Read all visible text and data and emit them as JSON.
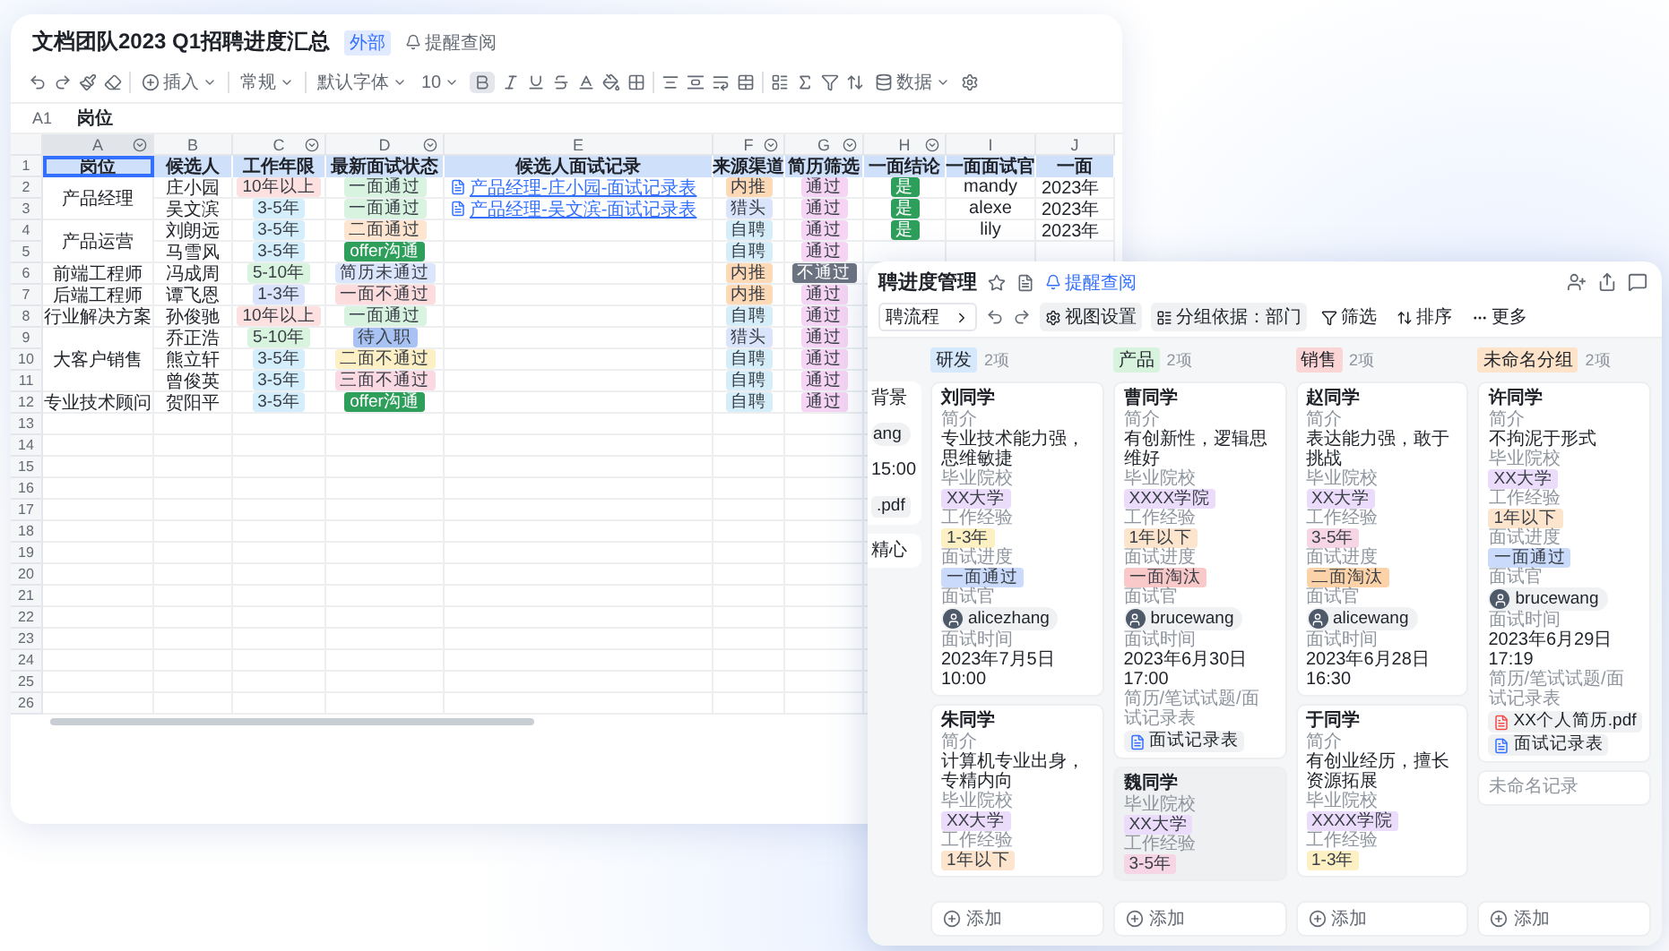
{
  "sheet": {
    "title": "文档团队2023 Q1招聘进度汇总",
    "badge": "外部",
    "remind": "提醒查阅",
    "toolbar": {
      "insert": "插入",
      "number_format": "常规",
      "font": "默认字体",
      "font_size": "10",
      "data": "数据",
      "bold": true
    },
    "cell_ref": "A1",
    "formula": "岗位",
    "columns": [
      {
        "letter": "A",
        "filter": true,
        "selected": true
      },
      {
        "letter": "B",
        "filter": false,
        "selected": false
      },
      {
        "letter": "C",
        "filter": true,
        "selected": false
      },
      {
        "letter": "D",
        "filter": true,
        "selected": false
      },
      {
        "letter": "E",
        "filter": false,
        "selected": false
      },
      {
        "letter": "F",
        "filter": true,
        "selected": false
      },
      {
        "letter": "G",
        "filter": true,
        "selected": false
      },
      {
        "letter": "H",
        "filter": true,
        "selected": false
      },
      {
        "letter": "I",
        "filter": false,
        "selected": false
      },
      {
        "letter": "J",
        "filter": false,
        "selected": false
      }
    ],
    "row_numbers": [
      "1",
      "2",
      "3",
      "4",
      "5",
      "6",
      "7",
      "8",
      "9",
      "10",
      "11",
      "12",
      "13",
      "14",
      "15",
      "16",
      "17",
      "18",
      "19",
      "20",
      "21",
      "22",
      "23",
      "24",
      "25",
      "26"
    ],
    "header": [
      "岗位",
      "候选人",
      "工作年限",
      "最新面试状态",
      "候选人面试记录",
      "来源渠道",
      "简历筛选",
      "一面结论",
      "一面面试官",
      "一面"
    ],
    "groups": [
      {
        "position": "产品经理",
        "candidates": [
          {
            "name": "庄小园",
            "years": {
              "text": "10年以上",
              "color": "#fde0e0"
            },
            "status": {
              "text": "一面通过",
              "color": "#d9f3e1"
            },
            "record": "产品经理-庄小园-面试记录表",
            "source": {
              "text": "内推",
              "color": "#fdd9b5"
            },
            "screening": {
              "text": "通过",
              "color": "#f6d4f4"
            },
            "result": {
              "text": "是",
              "color": "#2e9e5b"
            },
            "interviewer": "mandy",
            "date": "2023年"
          },
          {
            "name": "吴文滨",
            "years": {
              "text": "3-5年",
              "color": "#d5eefb"
            },
            "status": {
              "text": "一面通过",
              "color": "#d9f3e1"
            },
            "record": "产品经理-吴文滨-面试记录表",
            "source": {
              "text": "猎头",
              "color": "#dae4fa"
            },
            "screening": {
              "text": "通过",
              "color": "#f6d4f4"
            },
            "result": {
              "text": "是",
              "color": "#2e9e5b"
            },
            "interviewer": "alexe",
            "date": "2023年"
          }
        ]
      },
      {
        "position": "产品运营",
        "candidates": [
          {
            "name": "刘朗远",
            "years": {
              "text": "3-5年",
              "color": "#d5eefb"
            },
            "status": {
              "text": "二面通过",
              "color": "#fde5cf"
            },
            "source": {
              "text": "自聘",
              "color": "#d6eefa"
            },
            "screening": {
              "text": "通过",
              "color": "#f6d4f4"
            },
            "result": {
              "text": "是",
              "color": "#2e9e5b"
            },
            "interviewer": "lily",
            "date": "2023年"
          },
          {
            "name": "马雪风",
            "years": {
              "text": "3-5年",
              "color": "#d5eefb"
            },
            "status": {
              "text": "offer沟通",
              "color": "#2e9e5b"
            },
            "source": {
              "text": "自聘",
              "color": "#d6eefa"
            },
            "screening": {
              "text": "通过",
              "color": "#f6d4f4"
            }
          }
        ]
      },
      {
        "position": "前端工程师",
        "candidates": [
          {
            "name": "冯成周",
            "years": {
              "text": "5-10年",
              "color": "#d8f3de"
            },
            "status": {
              "text": "简历未通过",
              "color": "#dbe5fb"
            },
            "source": {
              "text": "内推",
              "color": "#fdd9b5"
            },
            "screening": {
              "text": "不通过",
              "color": "#6b7280"
            }
          }
        ]
      },
      {
        "position": "后端工程师",
        "candidates": [
          {
            "name": "谭飞恩",
            "years": {
              "text": "1-3年",
              "color": "#d9e3fb"
            },
            "status": {
              "text": "一面不通过",
              "color": "#fcdcdc"
            },
            "source": {
              "text": "内推",
              "color": "#fdd9b5"
            },
            "screening": {
              "text": "通过",
              "color": "#f6d4f4"
            }
          }
        ]
      },
      {
        "position": "行业解决方案",
        "candidates": [
          {
            "name": "孙俊驰",
            "years": {
              "text": "10年以上",
              "color": "#fde0e0"
            },
            "status": {
              "text": "一面通过",
              "color": "#d9f3e1"
            },
            "source": {
              "text": "自聘",
              "color": "#d6eefa"
            },
            "screening": {
              "text": "通过",
              "color": "#f6d4f4"
            }
          }
        ]
      },
      {
        "position": "大客户销售",
        "candidates": [
          {
            "name": "乔正浩",
            "years": {
              "text": "5-10年",
              "color": "#d8f3de"
            },
            "status": {
              "text": "待入职",
              "color": "#a8c3f3"
            },
            "source": {
              "text": "猎头",
              "color": "#dae4fa"
            },
            "screening": {
              "text": "通过",
              "color": "#f6d4f4"
            }
          },
          {
            "name": "熊立轩",
            "years": {
              "text": "3-5年",
              "color": "#d5eefb"
            },
            "status": {
              "text": "二面不通过",
              "color": "#fdf0c4"
            },
            "source": {
              "text": "自聘",
              "color": "#d6eefa"
            },
            "screening": {
              "text": "通过",
              "color": "#f6d4f4"
            }
          },
          {
            "name": "曾俊英",
            "years": {
              "text": "3-5年",
              "color": "#d5eefb"
            },
            "status": {
              "text": "三面不通过",
              "color": "#fbd9e3"
            },
            "source": {
              "text": "自聘",
              "color": "#d6eefa"
            },
            "screening": {
              "text": "通过",
              "color": "#f6d4f4"
            }
          }
        ]
      },
      {
        "position": "专业技术顾问",
        "candidates": [
          {
            "name": "贺阳平",
            "years": {
              "text": "3-5年",
              "color": "#d5eefb"
            },
            "status": {
              "text": "offer沟通",
              "color": "#2e9e5b"
            },
            "source": {
              "text": "自聘",
              "color": "#d6eefa"
            },
            "screening": {
              "text": "通过",
              "color": "#f6d4f4"
            }
          }
        ]
      }
    ]
  },
  "kanban": {
    "title": "聘进度管理",
    "remind": "提醒查阅",
    "view": "聘流程",
    "tools": [
      {
        "label": "视图设置",
        "kind": "settings"
      },
      {
        "label": "分组依据：部门",
        "kind": "group"
      },
      {
        "label": "筛选",
        "kind": "filter"
      },
      {
        "label": "排序",
        "kind": "sort"
      },
      {
        "label": "更多",
        "kind": "more"
      }
    ],
    "partial_cards": [
      {
        "lines": [
          {
            "kind": "text",
            "value": "背景"
          },
          {
            "kind": "person",
            "value": "ang"
          },
          {
            "kind": "text",
            "value": "15:00"
          },
          {
            "kind": "file",
            "value": ".pdf"
          }
        ]
      },
      {
        "lines": [
          {
            "kind": "text",
            "value": "精心"
          }
        ]
      }
    ],
    "columns": [
      {
        "name": "研发",
        "color": "#d6e8fb",
        "count": "2项",
        "add": "添加",
        "cards": [
          {
            "kind": "record",
            "title": "刘同学",
            "highlighted": false,
            "fields": [
              {
                "label": "简介",
                "kind": "text",
                "value": "专业技术能力强，思维敏捷"
              },
              {
                "label": "毕业院校",
                "kind": "tag",
                "value": "XX大学",
                "color": "#ecdcfb"
              },
              {
                "label": "工作经验",
                "kind": "tag",
                "value": "1-3年",
                "color": "#fdf0c2"
              },
              {
                "label": "面试进度",
                "kind": "tag",
                "value": "一面通过",
                "color": "#c9dafb"
              },
              {
                "label": "面试官",
                "kind": "person",
                "value": "alicezhang"
              },
              {
                "label": "面试时间",
                "kind": "text",
                "value": "2023年7月5日 10:00"
              }
            ]
          },
          {
            "kind": "record",
            "title": "朱同学",
            "highlighted": false,
            "fields": [
              {
                "label": "简介",
                "kind": "text",
                "value": "计算机专业出身，专精内向"
              },
              {
                "label": "毕业院校",
                "kind": "tag",
                "value": "XX大学",
                "color": "#ecdcfb"
              },
              {
                "label": "工作经验",
                "kind": "tag",
                "value": "1年以下",
                "color": "#fde4cc"
              }
            ]
          }
        ]
      },
      {
        "name": "产品",
        "color": "#d7f3dd",
        "count": "2项",
        "add": "添加",
        "cards": [
          {
            "kind": "record",
            "title": "曹同学",
            "highlighted": false,
            "fields": [
              {
                "label": "简介",
                "kind": "text",
                "value": "有创新性，逻辑思维好"
              },
              {
                "label": "毕业院校",
                "kind": "tag",
                "value": "XXXX学院",
                "color": "#ecdcfb"
              },
              {
                "label": "工作经验",
                "kind": "tag",
                "value": "1年以下",
                "color": "#fde4cc"
              },
              {
                "label": "面试进度",
                "kind": "tag",
                "value": "一面淘汰",
                "color": "#f9c9c9"
              },
              {
                "label": "面试官",
                "kind": "person",
                "value": "brucewang"
              },
              {
                "label": "面试时间",
                "kind": "text",
                "value": "2023年6月30日 17:00"
              },
              {
                "label": "简历/笔试试题/面试记录表",
                "kind": "files",
                "files": [
                  {
                    "name": "面试记录表",
                    "kind": "doc"
                  }
                ]
              }
            ]
          },
          {
            "kind": "record",
            "title": "魏同学",
            "highlighted": true,
            "fields": [
              {
                "label": "毕业院校",
                "kind": "tag",
                "value": "XX大学",
                "color": "#ecdcfb"
              },
              {
                "label": "工作经验",
                "kind": "tag",
                "value": "3-5年",
                "color": "#f6d5e5"
              }
            ]
          }
        ]
      },
      {
        "name": "销售",
        "color": "#fbd5d5",
        "count": "2项",
        "add": "添加",
        "cards": [
          {
            "kind": "record",
            "title": "赵同学",
            "highlighted": false,
            "fields": [
              {
                "label": "简介",
                "kind": "text",
                "value": "表达能力强，敢于挑战"
              },
              {
                "label": "毕业院校",
                "kind": "tag",
                "value": "XX大学",
                "color": "#ecdcfb"
              },
              {
                "label": "工作经验",
                "kind": "tag",
                "value": "3-5年",
                "color": "#f6d5e5"
              },
              {
                "label": "面试进度",
                "kind": "tag",
                "value": "二面淘汰",
                "color": "#fcd3a8"
              },
              {
                "label": "面试官",
                "kind": "person",
                "value": "alicewang"
              },
              {
                "label": "面试时间",
                "kind": "text",
                "value": "2023年6月28日 16:30"
              }
            ]
          },
          {
            "kind": "record",
            "title": "于同学",
            "highlighted": false,
            "fields": [
              {
                "label": "简介",
                "kind": "text",
                "value": "有创业经历，擅长资源拓展"
              },
              {
                "label": "毕业院校",
                "kind": "tag",
                "value": "XXXX学院",
                "color": "#ecdcfb"
              },
              {
                "label": "工作经验",
                "kind": "tag",
                "value": "1-3年",
                "color": "#fdf0c2"
              }
            ]
          }
        ]
      },
      {
        "name": "未命名分组",
        "color": "#fce3c9",
        "count": "2项",
        "add": "添加",
        "cards": [
          {
            "kind": "record",
            "title": "许同学",
            "highlighted": false,
            "fields": [
              {
                "label": "简介",
                "kind": "text",
                "value": "不拘泥于形式"
              },
              {
                "label": "毕业院校",
                "kind": "tag",
                "value": "XX大学",
                "color": "#ecdcfb"
              },
              {
                "label": "工作经验",
                "kind": "tag",
                "value": "1年以下",
                "color": "#fde4cc"
              },
              {
                "label": "面试进度",
                "kind": "tag",
                "value": "一面通过",
                "color": "#c9dafb"
              },
              {
                "label": "面试官",
                "kind": "person",
                "value": "brucewang"
              },
              {
                "label": "面试时间",
                "kind": "text",
                "value": "2023年6月29日 17:19"
              },
              {
                "label": "简历/笔试试题/面试记录表",
                "kind": "files",
                "files": [
                  {
                    "name": "XX个人简历.pdf",
                    "kind": "pdf"
                  },
                  {
                    "name": "面试记录表",
                    "kind": "doc"
                  }
                ]
              }
            ]
          },
          {
            "kind": "empty",
            "title": "未命名记录",
            "highlighted": false
          }
        ]
      }
    ]
  }
}
